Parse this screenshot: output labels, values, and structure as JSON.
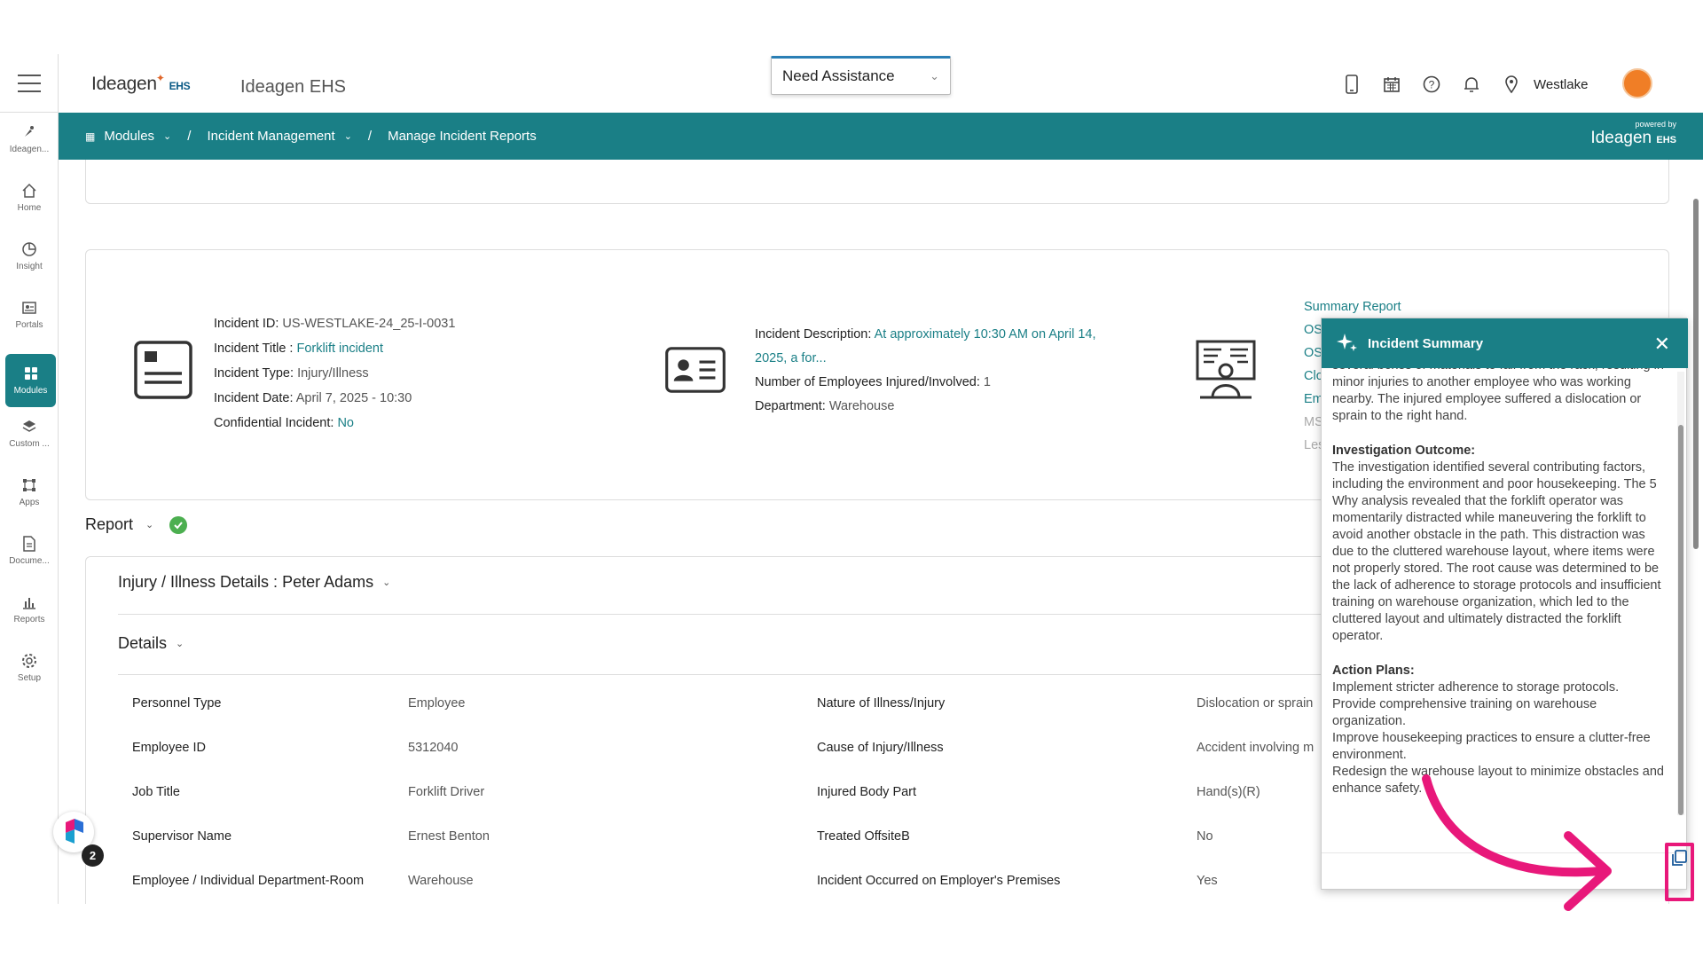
{
  "header": {
    "logo_text": "Ideagen",
    "logo_suffix": "EHS",
    "app_title": "Ideagen EHS",
    "assist_label": "Need Assistance",
    "location": "Westlake"
  },
  "sidebar": {
    "items": [
      {
        "label": "Ideagen..."
      },
      {
        "label": "Home"
      },
      {
        "label": "Insight"
      },
      {
        "label": "Portals"
      },
      {
        "label": "Modules"
      },
      {
        "label": "Custom ..."
      },
      {
        "label": "Apps"
      },
      {
        "label": "Docume..."
      },
      {
        "label": "Reports"
      },
      {
        "label": "Setup"
      }
    ]
  },
  "breadcrumb": {
    "items": [
      {
        "label": "Modules"
      },
      {
        "label": "Incident Management"
      },
      {
        "label": "Manage Incident Reports"
      }
    ],
    "separator": "/",
    "powered_by": "powered by",
    "powered_logo": "Ideagen",
    "powered_suffix": "EHS"
  },
  "incident": {
    "id_label": "Incident ID:",
    "id_value": "US-WESTLAKE-24_25-I-0031",
    "title_label": "Incident Title :",
    "title_value": "Forklift incident",
    "type_label": "Incident Type:",
    "type_value": "Injury/Illness",
    "date_label": "Incident Date:",
    "date_value": "April 7, 2025 - 10:30",
    "conf_label": "Confidential Incident:",
    "conf_value": "No",
    "desc_label": "Incident Description:",
    "desc_value_1": "At approximately 10:30 AM on April 14,",
    "desc_value_2": "2025, a for...",
    "emp_label": "Number of Employees Injured/Involved:",
    "emp_value": "1",
    "dept_label": "Department:",
    "dept_value": "Warehouse"
  },
  "summary_links": [
    "Summary Report",
    "OS",
    "OS",
    "Clo",
    "Em",
    "MS",
    "Les"
  ],
  "report": {
    "label": "Report",
    "section_title": "Injury / Illness Details : Peter Adams",
    "details_label": "Details",
    "rows": [
      {
        "k1": "Personnel Type",
        "v1": "Employee",
        "k2": "Nature of Illness/Injury",
        "v2": "Dislocation or sprain"
      },
      {
        "k1": "Employee ID",
        "v1": "5312040",
        "k2": "Cause of Injury/Illness",
        "v2": "Accident involving m"
      },
      {
        "k1": "Job Title",
        "v1": "Forklift Driver",
        "k2": "Injured Body Part",
        "v2": "Hand(s)(R)"
      },
      {
        "k1": "Supervisor Name",
        "v1": "Ernest Benton",
        "k2": "Treated OffsiteB",
        "v2": "No"
      },
      {
        "k1": "Employee / Individual Department-Room",
        "v1": "Warehouse",
        "k2": "Incident Occurred on Employer's Premises",
        "v2": "Yes"
      }
    ]
  },
  "panel": {
    "title": "Incident Summary",
    "intro": "several boxes of materials to fall from the rack, resulting in minor injuries to another employee who was working nearby. The injured employee suffered a dislocation or sprain to the right hand.",
    "outcome_title": "Investigation Outcome:",
    "outcome_text": "The investigation identified several contributing factors, including the environment and poor housekeeping. The 5 Why analysis revealed that the forklift operator was momentarily distracted while maneuvering the forklift to avoid another obstacle in the path. This distraction was due to the cluttered warehouse layout, where items were not properly stored. The root cause was determined to be the lack of adherence to storage protocols and insufficient training on warehouse organization, which led to the cluttered layout and ultimately distracted the forklift operator.",
    "plans_title": "Action Plans:",
    "plans": [
      "Implement stricter adherence to storage protocols.",
      "Provide comprehensive training on warehouse organization.",
      "Improve housekeeping practices to ensure a clutter-free environment.",
      "Redesign the warehouse layout to minimize obstacles and enhance safety."
    ]
  },
  "notification_count": "2",
  "colors": {
    "teal": "#1a7f86",
    "highlight": "#e8187a",
    "avatar": "#f07e26"
  }
}
